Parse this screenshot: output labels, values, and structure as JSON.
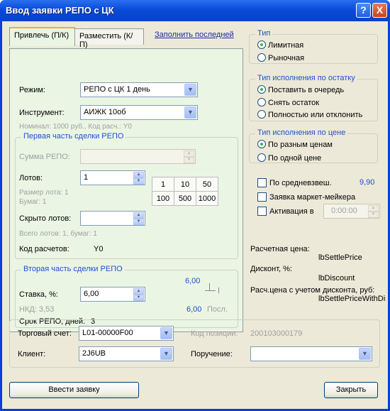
{
  "window": {
    "title": "Ввод заявки РЕПО с ЦК",
    "help_label": "?",
    "close_label": "X"
  },
  "tabs": [
    {
      "label": "Привлечь (П/К)"
    },
    {
      "label": "Разместить (К/П)"
    }
  ],
  "fill_last_link": "Заполнить последней",
  "form": {
    "mode_label": "Режим:",
    "mode_value": "РЕПО с ЦК 1 день",
    "instrument_label": "Инструмент:",
    "instrument_value": "АИЖК 10об",
    "nominal_info": "Номинал: 1000 руб., Код расч.: Y0"
  },
  "first_part": {
    "title": "Первая часть сделки РЕПО",
    "sum_label": "Сумма РЕПО:",
    "sum_value": "",
    "lots_label": "Лотов:",
    "lots_value": "1",
    "lot_size_info": "Размер лота: 1",
    "papers_info": "Бумаг: 1",
    "lot_buttons": [
      [
        "1",
        "10",
        "50"
      ],
      [
        "100",
        "500",
        "1000"
      ]
    ],
    "hidden_lots_label": "Скрыто лотов:",
    "hidden_lots_value": "",
    "total_lots_info": "Всего лотов: 1, бумаг: 1",
    "settle_code_label": "Код расчетов:",
    "settle_code_value": "Y0"
  },
  "second_part": {
    "title": "Вторая часть сделки РЕПО",
    "rate_label": "Ставка, %:",
    "rate_value": "6,00",
    "rate_top": "6,00",
    "nkd_label": "НКД: 3,53",
    "rate_last_value": "6,00",
    "rate_last_label": "Посл.",
    "term_label": "Срок РЕПО, дней:",
    "term_value": "3"
  },
  "type_group": {
    "title": "Тип",
    "options": [
      {
        "label": "Лимитная",
        "checked": true
      },
      {
        "label": "Рыночная",
        "checked": false
      }
    ]
  },
  "remainder_group": {
    "title": "Тип исполнения по остатку",
    "options": [
      {
        "label": "Поставить в очередь",
        "checked": true
      },
      {
        "label": "Снять остаток",
        "checked": false
      },
      {
        "label": "Полностью или отклонить",
        "checked": false
      }
    ]
  },
  "price_group": {
    "title": "Тип исполнения по цене",
    "options": [
      {
        "label": "По разным ценам",
        "checked": true
      },
      {
        "label": "По одной цене",
        "checked": false
      }
    ]
  },
  "options": {
    "avg_weighted_label": "По средневзвеш.",
    "avg_weighted_value": "9,90",
    "market_maker_label": "Заявка маркет-мейкера",
    "activation_label": "Активация в",
    "activation_time": "0:00:00"
  },
  "settlement": {
    "price_label": "Расчетная цена:",
    "price_value": "lbSettlePrice",
    "discount_label": "Дисконт, %:",
    "discount_value": "lbDiscount",
    "price_with_discount_label": "Расч.цена с учетом дисконта, руб:",
    "price_with_discount_value": "lbSettlePriceWithDis"
  },
  "account": {
    "account_label": "Торговый счет:",
    "account_value": "L01-00000F00",
    "position_code_label": "Код позиции:",
    "position_code_value": "200103000179",
    "client_label": "Клиент:",
    "client_value": "2J6UB",
    "order_label": "Поручение:",
    "order_value": ""
  },
  "buttons": {
    "submit": "Ввести заявку",
    "close": "Закрыть"
  }
}
